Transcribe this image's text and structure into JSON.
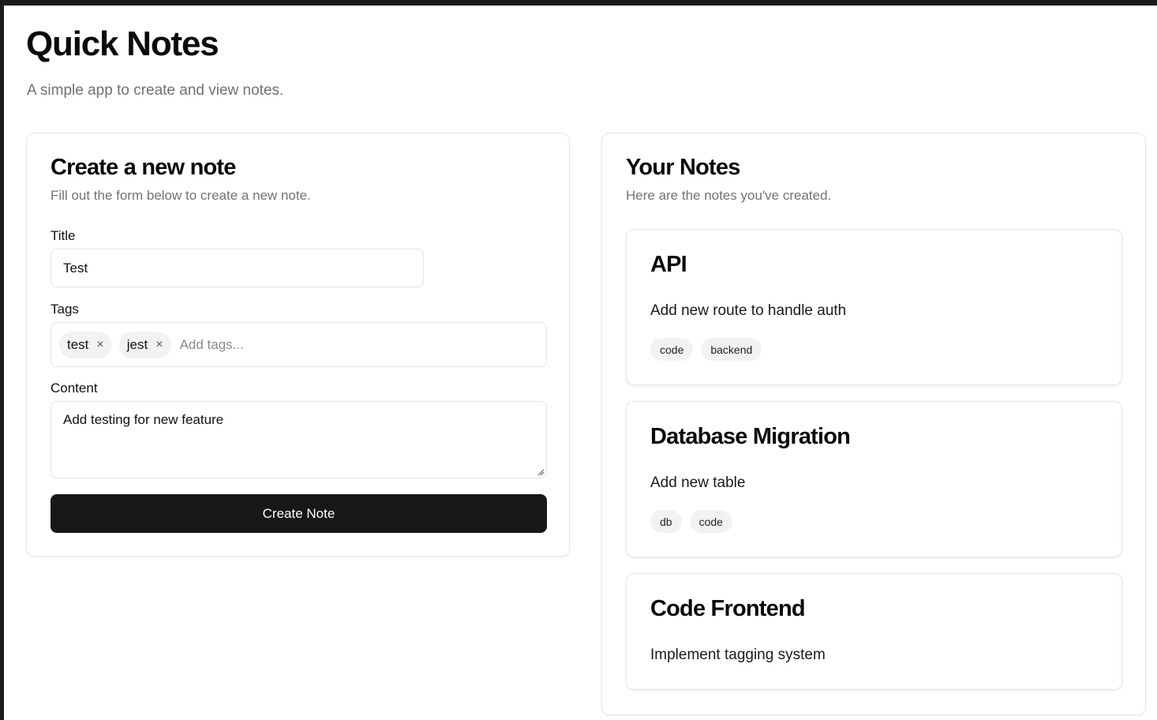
{
  "app": {
    "title": "Quick Notes",
    "subtitle": "A simple app to create and view notes."
  },
  "create_form": {
    "title": "Create a new note",
    "description": "Fill out the form below to create a new note.",
    "title_label": "Title",
    "title_value": "Test",
    "tags_label": "Tags",
    "tags": [
      {
        "label": "test",
        "remove_glyph": "×"
      },
      {
        "label": "jest",
        "remove_glyph": "×"
      }
    ],
    "tags_placeholder": "Add tags...",
    "content_label": "Content",
    "content_value": "Add testing for new feature",
    "submit_label": "Create Note"
  },
  "notes_panel": {
    "title": "Your Notes",
    "description": "Here are the notes you've created.",
    "notes": [
      {
        "title": "API",
        "content": "Add new route to handle auth",
        "tags": [
          "code",
          "backend"
        ]
      },
      {
        "title": "Database Migration",
        "content": "Add new table",
        "tags": [
          "db",
          "code"
        ]
      },
      {
        "title": "Code Frontend",
        "content": "Implement tagging system",
        "tags": []
      }
    ]
  },
  "colors": {
    "primary_button": "#171717",
    "muted_text": "#737373",
    "chip_background": "#f2f2f2"
  }
}
